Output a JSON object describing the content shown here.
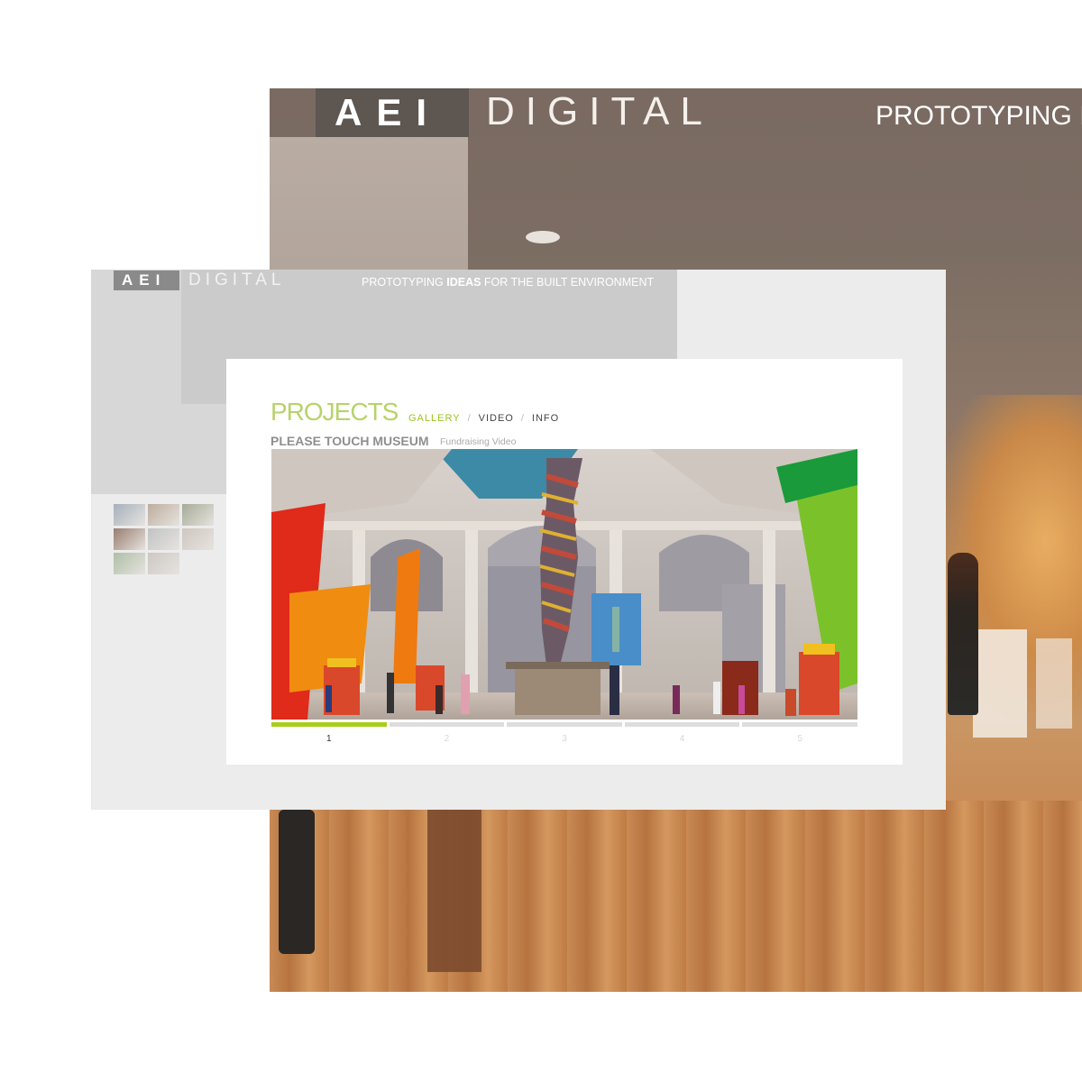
{
  "background_window": {
    "logo_aei": "AEI",
    "logo_digital": "DIGITAL",
    "tagline": "PROTOTYPING I"
  },
  "middle_window": {
    "logo_aei": "AEI",
    "logo_digital": "DIGITAL",
    "tagline_part1": "PROTOTYPING ",
    "tagline_bold": "IDEAS",
    "tagline_part2": " FOR THE BUILT ENVIRONMENT",
    "thumbnails": [
      {
        "color": "#9aa6b4"
      },
      {
        "color": "#b5a290"
      },
      {
        "color": "#9a9f88"
      },
      {
        "color": "#8a6a5a"
      },
      {
        "color": "#b9bcbd"
      },
      {
        "color": "#c9c0b8"
      },
      {
        "color": "#a3b79a"
      },
      {
        "color": "#c7c1bb"
      }
    ]
  },
  "content": {
    "section_title": "PROJECTS",
    "nav": {
      "gallery": "GALLERY",
      "separator": "/",
      "video": "VIDEO",
      "info": "INFO"
    },
    "project_name": "PLEASE TOUCH MUSEUM",
    "project_subtitle": "Fundraising Video",
    "pager": [
      "1",
      "2",
      "3",
      "4",
      "5"
    ],
    "active_page": "1"
  },
  "colors": {
    "accent_green": "#a9cd1a",
    "title_green": "#b8d36a",
    "panel_gray": "#ececec"
  }
}
